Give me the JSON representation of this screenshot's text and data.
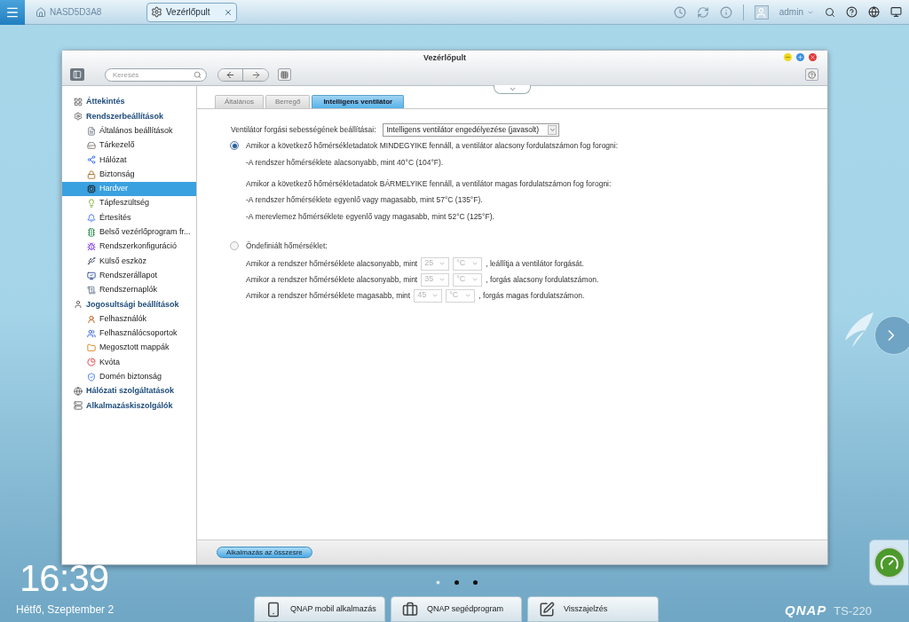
{
  "topbar": {
    "home_tab": "NASD5D3A8",
    "app_tab": {
      "label": "Vezérlőpult",
      "selected": true
    },
    "user": "admin"
  },
  "window": {
    "title": "Vezérlőpult",
    "search": {
      "placeholder": "Keresés"
    },
    "sidebar": [
      {
        "label": "Áttekintés",
        "selected": false
      },
      {
        "label": "Rendszerbeállítások",
        "selected": false,
        "children": [
          {
            "label": "Általános beállítások",
            "selected": false
          },
          {
            "label": "Tárkezelő",
            "selected": false
          },
          {
            "label": "Hálózat",
            "selected": false
          },
          {
            "label": "Biztonság",
            "selected": false
          },
          {
            "label": "Hardver",
            "selected": true
          },
          {
            "label": "Tápfeszültség",
            "selected": false
          },
          {
            "label": "Értesítés",
            "selected": false
          },
          {
            "label": "Belső vezérlőprogram fr...",
            "selected": false
          },
          {
            "label": "Rendszerkonfiguráció",
            "selected": false
          },
          {
            "label": "Külső eszköz",
            "selected": false
          },
          {
            "label": "Rendszerállapot",
            "selected": false
          },
          {
            "label": "Rendszernaplók",
            "selected": false
          }
        ]
      },
      {
        "label": "Jogosultsági beállítások",
        "selected": false,
        "children": [
          {
            "label": "Felhasználók",
            "selected": false
          },
          {
            "label": "Felhasználócsoportok",
            "selected": false
          },
          {
            "label": "Megosztott mappák",
            "selected": false
          },
          {
            "label": "Kvóta",
            "selected": false
          },
          {
            "label": "Domén biztonság",
            "selected": false
          }
        ]
      },
      {
        "label": "Hálózati szolgáltatások",
        "selected": false
      },
      {
        "label": "Alkalmazáskiszolgálók",
        "selected": false
      }
    ],
    "tabs": [
      {
        "label": "Általános",
        "selected": false
      },
      {
        "label": "Berregő",
        "selected": false
      },
      {
        "label": "Intelligens ventilátor",
        "selected": true
      }
    ],
    "setting": {
      "label": "Ventilátor forgási sebességének beállításai:",
      "value": "Intelligens ventilátor engedélyezése (javasolt)"
    },
    "smart_option": {
      "label": "Amikor a következő hőmérsékletadatok MINDEGYIKE fennáll, a ventilátor alacsony fordulatszámon fog forogni:",
      "selected": true,
      "lines": [
        "-A rendszer hőmérséklete alacsonyabb, mint 40°C (104°F).",
        "Amikor a következő hőmérsékletadatok BÁRMELYIKE fennáll, a ventilátor magas fordulatszámon fog forogni:",
        "-A rendszer hőmérséklete egyenlő vagy magasabb, mint 57°C (135°F).",
        "-A merevlemez hőmérséklete egyenlő vagy magasabb, mint 52°C (125°F)."
      ]
    },
    "custom_option": {
      "label": "Öndefiniált hőmérséklet:",
      "selected": false,
      "rows": [
        {
          "prefix": "Amikor a rendszer hőmérséklete alacsonyabb, mint",
          "value": "25",
          "unit": "°C",
          "suffix": ", leállítja a ventilátor forgását.",
          "disabled": true
        },
        {
          "prefix": "Amikor a rendszer hőmérséklete alacsonyabb, mint",
          "value": "35",
          "unit": "°C",
          "suffix": ", forgás alacsony fordulatszámon.",
          "disabled": true
        },
        {
          "prefix": "Amikor a rendszer hőmérséklete magasabb, mint",
          "value": "45",
          "unit": "°C",
          "suffix": ", forgás magas fordulatszámon.",
          "disabled": true
        }
      ]
    },
    "apply_button": "Alkalmazás az összesre"
  },
  "desktop": {
    "time": "16:39",
    "date": "Hétfő, Szeptember 2",
    "page_dots": [
      {
        "selected": true
      },
      {
        "selected": false
      },
      {
        "selected": false
      }
    ],
    "dock": [
      "QNAP mobil alkalmazás",
      "QNAP segédprogram",
      "Visszajelzés"
    ],
    "logo": "QNAP",
    "model": "TS-220"
  }
}
